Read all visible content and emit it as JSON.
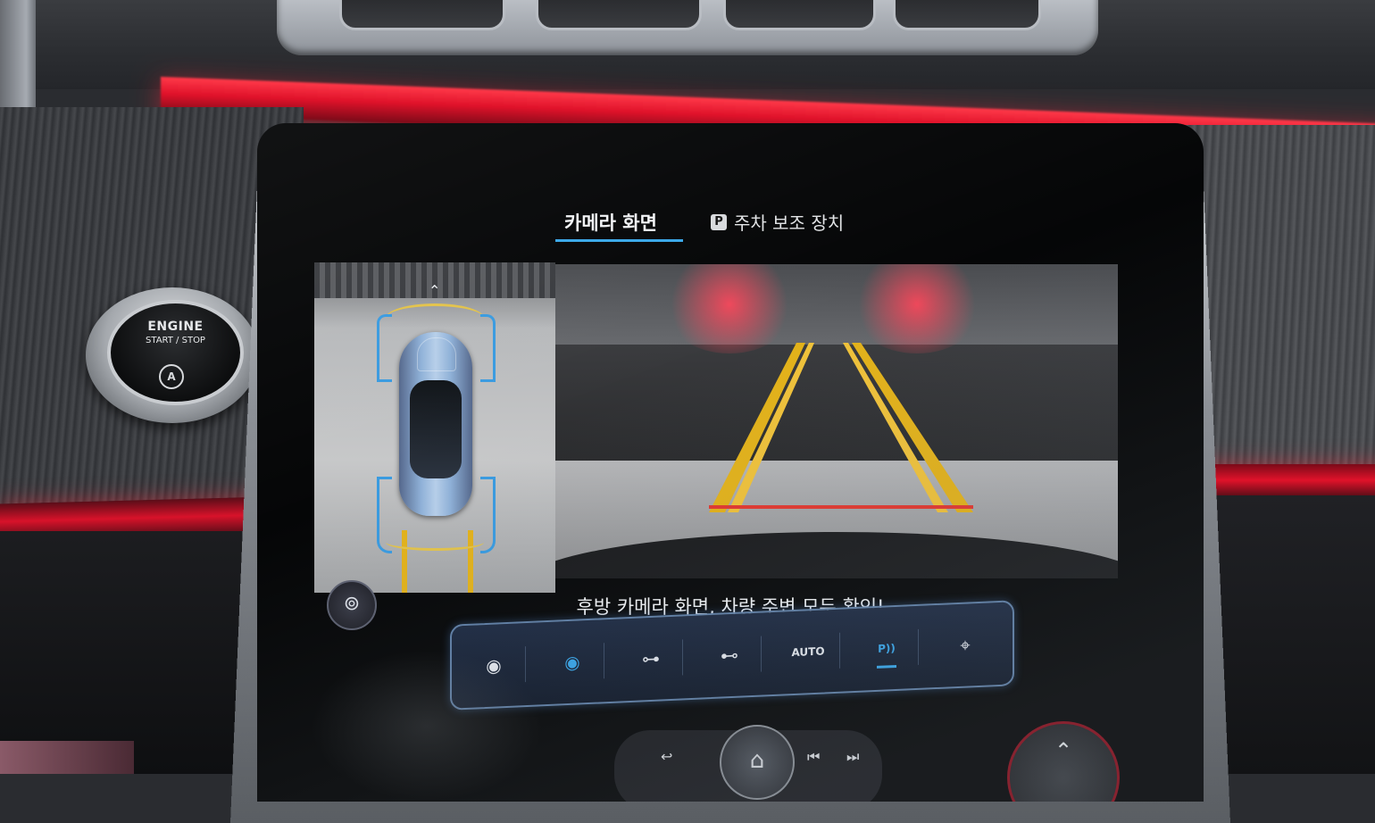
{
  "engine_button": {
    "line1": "ENGINE",
    "line2": "START / STOP",
    "icon": "auto-start-stop-icon",
    "icon_glyph": "A"
  },
  "display": {
    "tabs": [
      {
        "label": "카메라 화면",
        "active": true
      },
      {
        "label": "주차 보조 장치",
        "badge": "P",
        "active": false
      }
    ],
    "caption": "후방 카메라 화면, 차량 주변 모두 확인!",
    "view_switch_icon": "camera-view-switch-icon",
    "toolbar": [
      {
        "icon": "front-sensor-icon",
        "glyph": "◉",
        "active": false
      },
      {
        "icon": "rear-sensor-icon",
        "glyph": "◉",
        "active": true
      },
      {
        "icon": "car-side-left-icon",
        "glyph": "⊶",
        "active": false
      },
      {
        "icon": "car-side-right-icon",
        "glyph": "⊷",
        "active": false
      },
      {
        "icon": "auto-view-icon",
        "glyph": "AUTO",
        "active": false
      },
      {
        "icon": "parking-sensor-icon",
        "glyph": "P))",
        "active": true
      },
      {
        "icon": "remote-park-icon",
        "glyph": "⌖",
        "active": false
      }
    ],
    "bottom_controls": {
      "back_icon": "back-icon",
      "home_icon": "home-icon",
      "prev_icon": "previous-track-icon",
      "next_icon": "next-track-icon",
      "up_icon": "chevron-up-icon"
    }
  },
  "colors": {
    "ambient_red": "#e0122a",
    "accent_blue": "#39a7e8",
    "guide_yellow": "#e3b21a",
    "guide_red": "#e2382f"
  }
}
